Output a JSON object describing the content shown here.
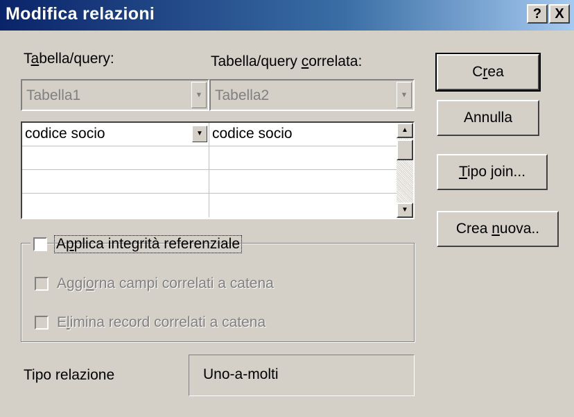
{
  "dialog": {
    "title": "Modifica relazioni",
    "help_label": "?",
    "close_label": "X"
  },
  "table_label": {
    "pre": "T",
    "key": "a",
    "post": "bella/query:"
  },
  "related_label": {
    "pre": "Tabella/query ",
    "key": "c",
    "post": "orrelata:"
  },
  "table_value": "Tabella1",
  "related_value": "Tabella2",
  "grid": {
    "rows": [
      {
        "left": "codice socio",
        "right": "codice socio"
      },
      {
        "left": "",
        "right": ""
      },
      {
        "left": "",
        "right": ""
      },
      {
        "left": "",
        "right": ""
      }
    ]
  },
  "buttons": {
    "crea": {
      "pre": "C",
      "key": "r",
      "post": "ea"
    },
    "annulla": "Annulla",
    "tipo_join": {
      "pre": "",
      "key": "T",
      "post": "ipo join..."
    },
    "crea_nuova": {
      "pre": "Crea ",
      "key": "n",
      "post": "uova.."
    }
  },
  "options": {
    "integrity": {
      "pre": "A",
      "key": "p",
      "post": "plica integrità referenziale",
      "checked": false
    },
    "cascade_update": {
      "pre": "Aggi",
      "key": "o",
      "post": "rna campi correlati a catena",
      "checked": false
    },
    "cascade_delete": {
      "pre": "E",
      "key": "l",
      "post": "imina record correlati a catena",
      "checked": false
    }
  },
  "relation_type": {
    "label": "Tipo relazione",
    "value": "Uno-a-molti"
  },
  "colors": {
    "title_start": "#0a246a",
    "title_end": "#a6caf0",
    "face": "#d4d0c8"
  }
}
